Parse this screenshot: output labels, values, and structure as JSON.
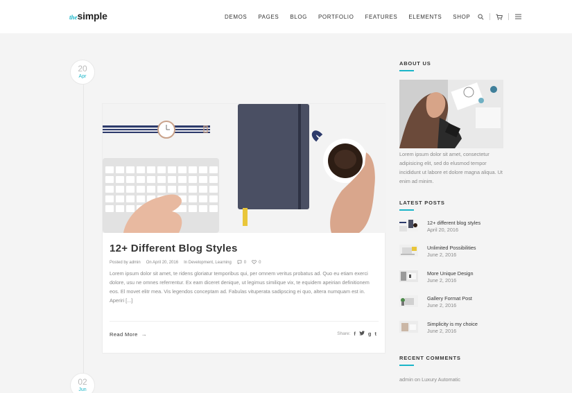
{
  "header": {
    "logo_the": "the",
    "logo_simple": "simple",
    "nav": [
      "DEMOS",
      "PAGES",
      "BLOG",
      "PORTFOLIO",
      "FEATURES",
      "ELEMENTS",
      "SHOP"
    ],
    "icons": [
      "search-icon",
      "cart-icon",
      "menu-icon"
    ]
  },
  "timeline": {
    "dates": [
      {
        "day": "20",
        "month": "Apr"
      },
      {
        "day": "02",
        "month": "Jun"
      }
    ]
  },
  "post": {
    "title": "12+ Different Blog Styles",
    "meta_author": "Posted by admin",
    "meta_date": "On April 20, 2016",
    "meta_categories": "In Development, Learning",
    "comments_count": "0",
    "likes_count": "0",
    "excerpt": "Lorem ipsum dolor sit amet, te ridens gloriatur temporibus qui, per omnem veritus probatus ad. Quo eu etiam exerci dolore, usu ne omnes referrentur. Ex eam diceret denique, ut legimus similique vix, te equidem apeirian definitionem eos. El movet elitr mea. Vis legendos conceptam ad. Fabulas vituperata sadipscing ei quo, altera numquam est in. Aperiri [...]",
    "read_more": "Read More",
    "share_label": "Share:",
    "share_icons": [
      "facebook-icon",
      "twitter-icon",
      "google-plus-icon",
      "tumblr-icon"
    ]
  },
  "sidebar": {
    "about": {
      "title": "ABOUT US",
      "text": "Lorem ipsum dolor sit amet, consectetur adipisicing elit, sed do elusmod tempor incididunt ut labore et dolore magna aliqua. Ut enim ad minim."
    },
    "latest_posts": {
      "title": "LATEST POSTS",
      "items": [
        {
          "title": "12+ different blog styles",
          "date": "April 20, 2016"
        },
        {
          "title": "Unlimited Possibilities",
          "date": "June 2, 2016"
        },
        {
          "title": "More Unique Design",
          "date": "June 2, 2016"
        },
        {
          "title": "Gallery Format Post",
          "date": "June 2, 2016"
        },
        {
          "title": "Simplicity is my choice",
          "date": "June 2, 2016"
        }
      ]
    },
    "recent_comments": {
      "title": "RECENT COMMENTS",
      "items": [
        {
          "author": "admin",
          "on": "on",
          "post": "Luxury Automatic"
        }
      ]
    }
  },
  "colors": {
    "accent": "#1ab5c8",
    "background": "#f4f4f4",
    "header_bg": "#ffffff"
  }
}
